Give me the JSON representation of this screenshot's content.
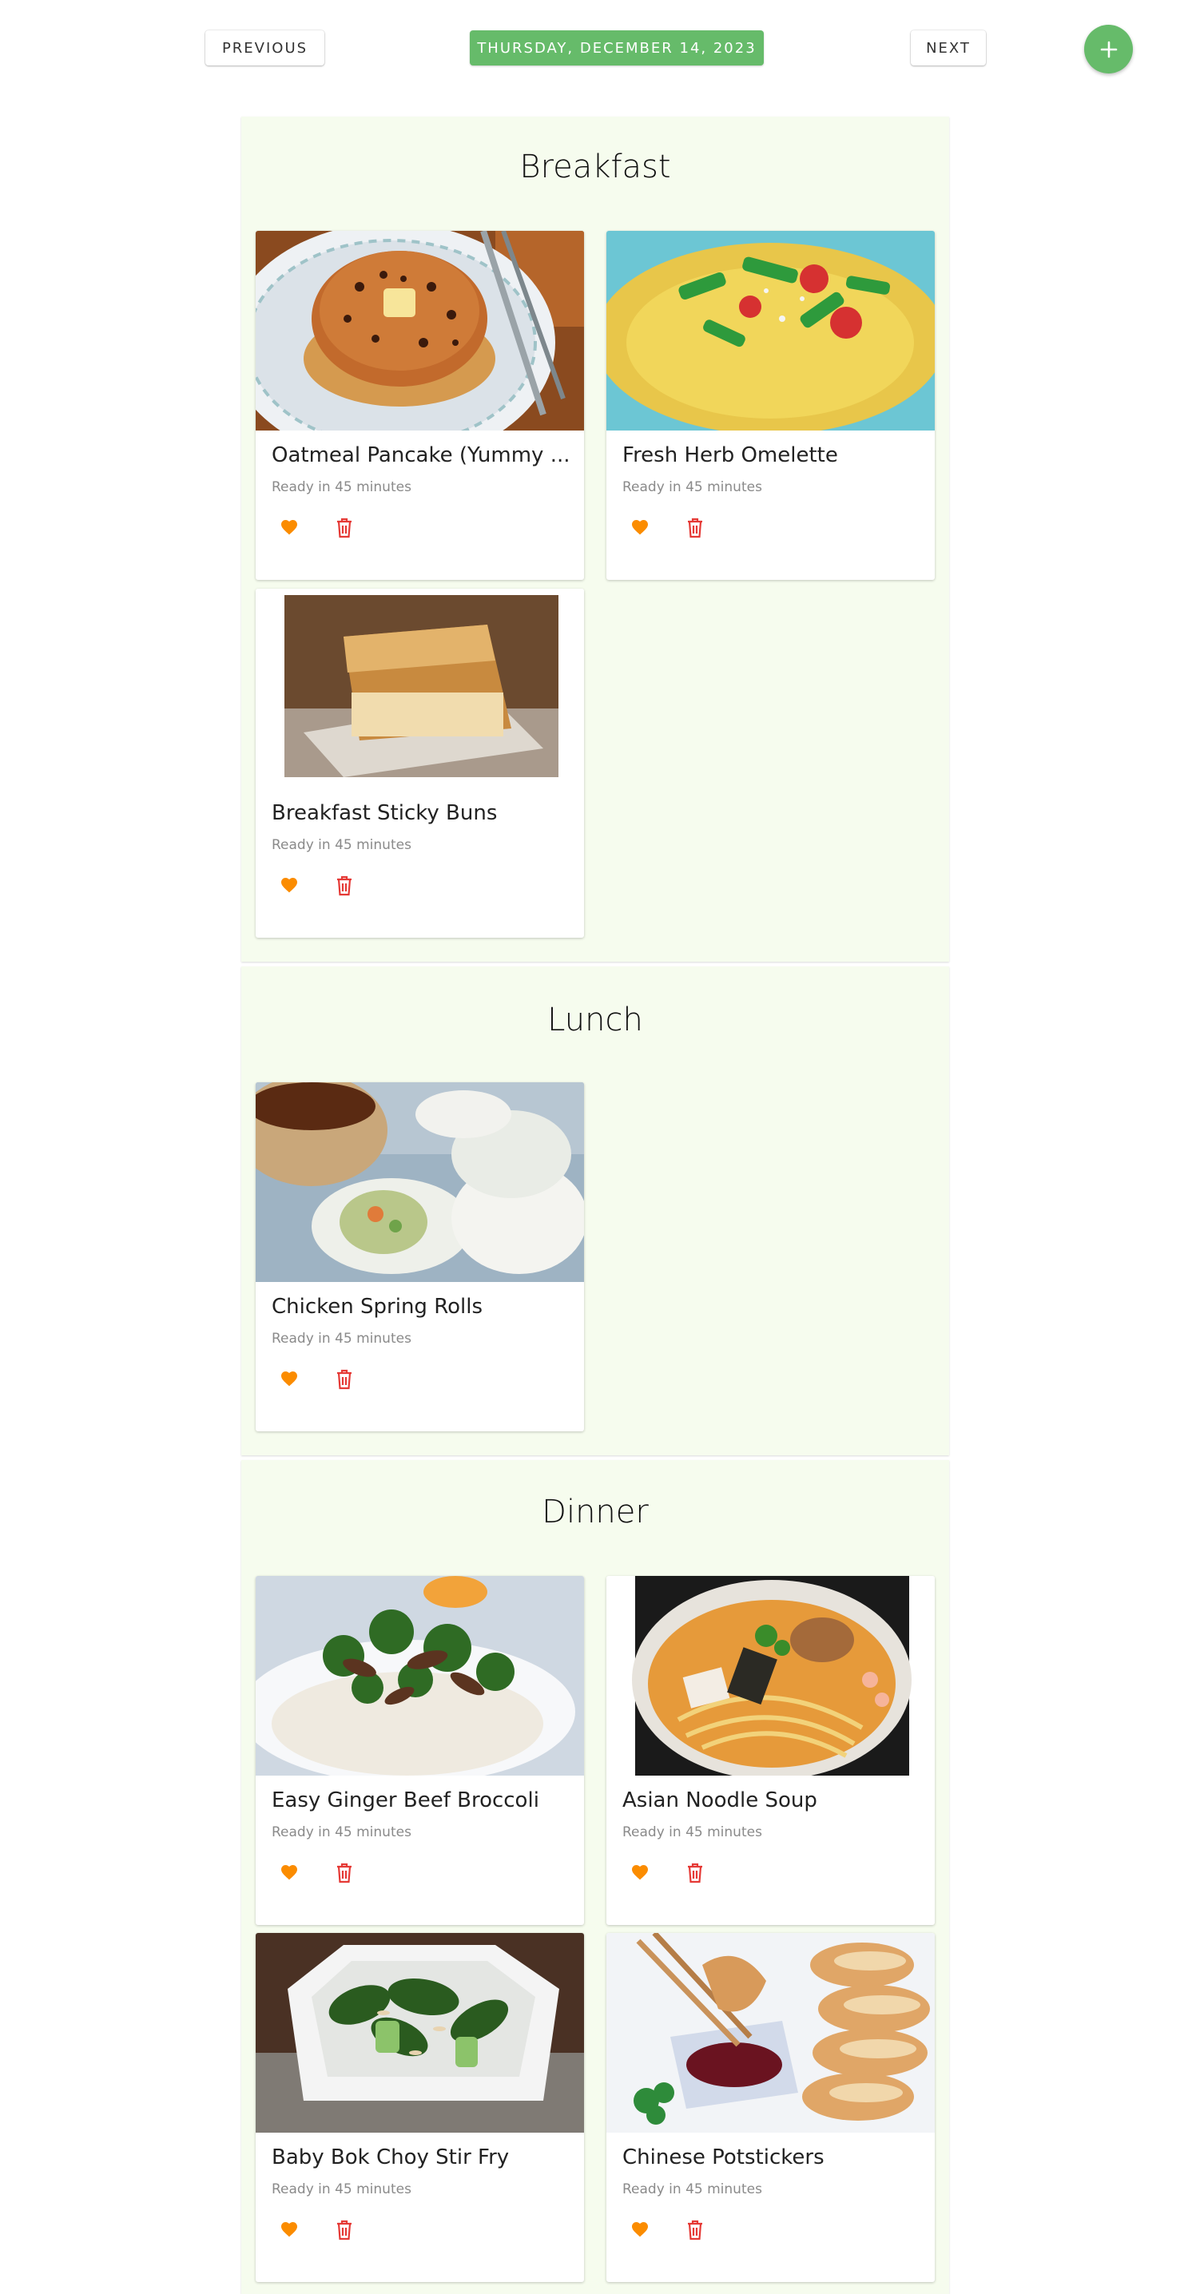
{
  "nav": {
    "previous_label": "PREVIOUS",
    "date_label": "THURSDAY, DECEMBER 14, 2023",
    "next_label": "NEXT",
    "add_icon": "plus-icon"
  },
  "colors": {
    "accent_green": "#66bb6a",
    "section_bg": "#f6fcee",
    "heart": "#fb8c00",
    "trash": "#e53935"
  },
  "meals": [
    {
      "title": "Breakfast",
      "recipes": [
        {
          "title": "Oatmeal Pancake (Yummy ...",
          "subtitle": "Ready in 45 minutes",
          "image": "pancake-photo"
        },
        {
          "title": "Fresh Herb Omelette",
          "subtitle": "Ready in 45 minutes",
          "image": "omelette-photo"
        },
        {
          "title": "Breakfast Sticky Buns",
          "subtitle": "Ready in 45 minutes",
          "image": "sticky-buns-photo"
        }
      ]
    },
    {
      "title": "Lunch",
      "recipes": [
        {
          "title": "Chicken Spring Rolls",
          "subtitle": "Ready in 45 minutes",
          "image": "spring-rolls-photo"
        }
      ]
    },
    {
      "title": "Dinner",
      "recipes": [
        {
          "title": "Easy Ginger Beef Broccoli",
          "subtitle": "Ready in 45 minutes",
          "image": "beef-broccoli-photo"
        },
        {
          "title": "Asian Noodle Soup",
          "subtitle": "Ready in 45 minutes",
          "image": "noodle-soup-photo"
        },
        {
          "title": "Baby Bok Choy Stir Fry",
          "subtitle": "Ready in 45 minutes",
          "image": "bok-choy-photo"
        },
        {
          "title": "Chinese Potstickers",
          "subtitle": "Ready in 45 minutes",
          "image": "potstickers-photo"
        }
      ]
    }
  ]
}
